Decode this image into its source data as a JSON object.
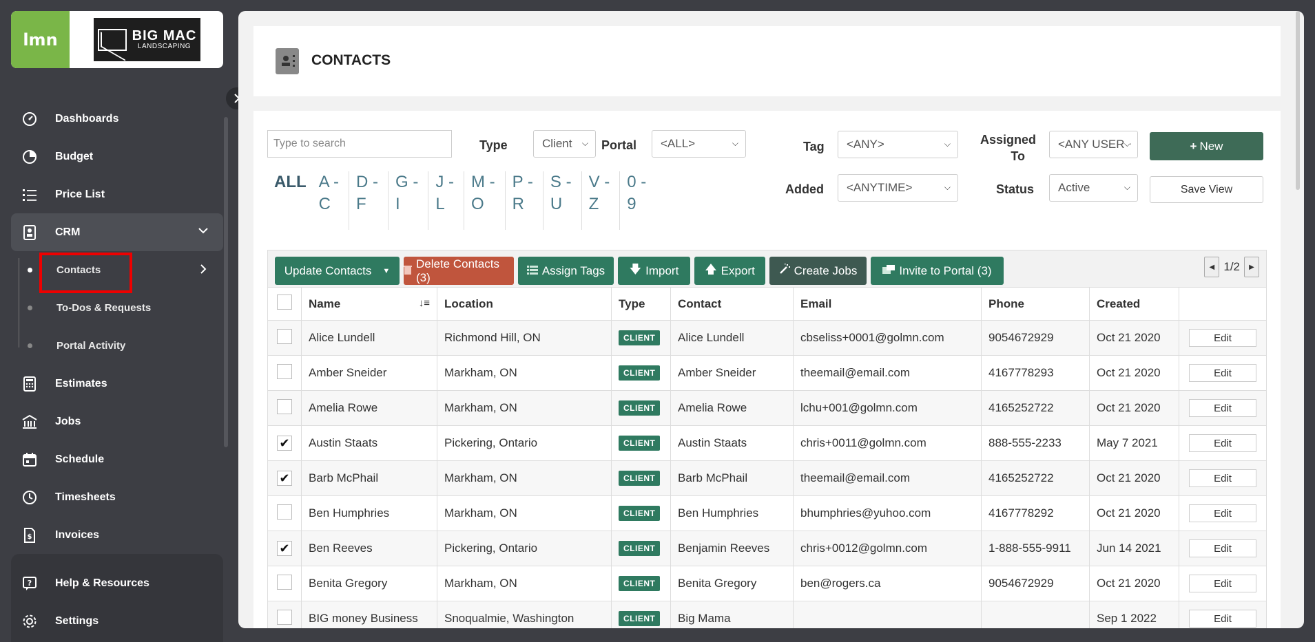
{
  "brand": {
    "lmn_logo": "lmn",
    "company_line1": "BIG MAC",
    "company_line2": "LANDSCAPING"
  },
  "nav": {
    "items": [
      {
        "label": "Dashboards",
        "icon": "gauge-icon"
      },
      {
        "label": "Budget",
        "icon": "pie-chart-icon"
      },
      {
        "label": "Price List",
        "icon": "list-icon"
      },
      {
        "label": "CRM",
        "icon": "contact-card-icon"
      }
    ],
    "crm_sub": [
      {
        "label": "Contacts"
      },
      {
        "label": "To-Dos & Requests"
      },
      {
        "label": "Portal Activity"
      }
    ],
    "items2": [
      {
        "label": "Estimates",
        "icon": "calculator-icon"
      },
      {
        "label": "Jobs",
        "icon": "building-icon"
      },
      {
        "label": "Schedule",
        "icon": "calendar-icon"
      },
      {
        "label": "Timesheets",
        "icon": "clock-icon"
      },
      {
        "label": "Invoices",
        "icon": "invoice-icon"
      }
    ],
    "bottom": [
      {
        "label": "Help & Resources",
        "icon": "help-icon"
      },
      {
        "label": "Settings",
        "icon": "gear-icon"
      }
    ]
  },
  "page": {
    "title": "CONTACTS"
  },
  "filters": {
    "search_placeholder": "Type to search",
    "type_label": "Type",
    "type_value": "Client",
    "portal_label": "Portal",
    "portal_value": "<ALL>",
    "tag_label": "Tag",
    "tag_value": "<ANY>",
    "assigned_label_1": "Assigned",
    "assigned_label_2": "To",
    "assigned_value": "<ANY USER>",
    "added_label": "Added",
    "added_value": "<ANYTIME>",
    "status_label": "Status",
    "status_value": "Active",
    "new_button": "New",
    "save_view_button": "Save View"
  },
  "alphabet": [
    {
      "l1": "ALL",
      "l2": ""
    },
    {
      "l1": "A -",
      "l2": "C"
    },
    {
      "l1": "D -",
      "l2": "F"
    },
    {
      "l1": "G -",
      "l2": "I"
    },
    {
      "l1": "J -",
      "l2": "L"
    },
    {
      "l1": "M -",
      "l2": "O"
    },
    {
      "l1": "P -",
      "l2": "R"
    },
    {
      "l1": "S -",
      "l2": "U"
    },
    {
      "l1": "V -",
      "l2": "Z"
    },
    {
      "l1": "0 -",
      "l2": "9"
    }
  ],
  "toolbar": {
    "update": "Update Contacts",
    "delete": "Delete Contacts (3)",
    "assign_tags": "Assign Tags",
    "import": "Import",
    "export": "Export",
    "create_jobs": "Create Jobs",
    "invite": "Invite to Portal (3)",
    "page_indicator": "1/2"
  },
  "table": {
    "headers": [
      "Name",
      "Location",
      "Type",
      "Contact",
      "Email",
      "Phone",
      "Created"
    ],
    "edit_label": "Edit",
    "rows": [
      {
        "checked": false,
        "name": "Alice Lundell",
        "location": "Richmond Hill, ON",
        "type": "CLIENT",
        "contact": "Alice Lundell",
        "email": "cbseliss+0001@golmn.com",
        "phone": "9054672929",
        "created": "Oct 21 2020"
      },
      {
        "checked": false,
        "name": "Amber Sneider",
        "location": "Markham, ON",
        "type": "CLIENT",
        "contact": "Amber Sneider",
        "email": "theemail@email.com",
        "phone": "4167778293",
        "created": "Oct 21 2020"
      },
      {
        "checked": false,
        "name": "Amelia Rowe",
        "location": "Markham, ON",
        "type": "CLIENT",
        "contact": "Amelia Rowe",
        "email": "lchu+001@golmn.com",
        "phone": "4165252722",
        "created": "Oct 21 2020"
      },
      {
        "checked": true,
        "name": "Austin Staats",
        "location": "Pickering, Ontario",
        "type": "CLIENT",
        "contact": "Austin Staats",
        "email": "chris+0011@golmn.com",
        "phone": "888-555-2233",
        "created": "May 7 2021"
      },
      {
        "checked": true,
        "name": "Barb McPhail",
        "location": "Markham, ON",
        "type": "CLIENT",
        "contact": "Barb McPhail",
        "email": "theemail@email.com",
        "phone": "4165252722",
        "created": "Oct 21 2020"
      },
      {
        "checked": false,
        "name": "Ben Humphries",
        "location": "Markham, ON",
        "type": "CLIENT",
        "contact": "Ben Humphries",
        "email": "bhumphries@yuhoo.com",
        "phone": "4167778292",
        "created": "Oct 21 2020"
      },
      {
        "checked": true,
        "name": "Ben Reeves",
        "location": "Pickering, Ontario",
        "type": "CLIENT",
        "contact": "Benjamin Reeves",
        "email": "chris+0012@golmn.com",
        "phone": "1-888-555-9911",
        "created": "Jun 14 2021"
      },
      {
        "checked": false,
        "name": "Benita Gregory",
        "location": "Markham, ON",
        "type": "CLIENT",
        "contact": "Benita Gregory",
        "email": "ben@rogers.ca",
        "phone": "9054672929",
        "created": "Oct 21 2020"
      },
      {
        "checked": false,
        "name": "BIG money Business",
        "location": "Snoqualmie, Washington",
        "type": "CLIENT",
        "contact": "Big Mama",
        "email": "",
        "phone": "",
        "created": "Sep 1 2022"
      }
    ]
  }
}
